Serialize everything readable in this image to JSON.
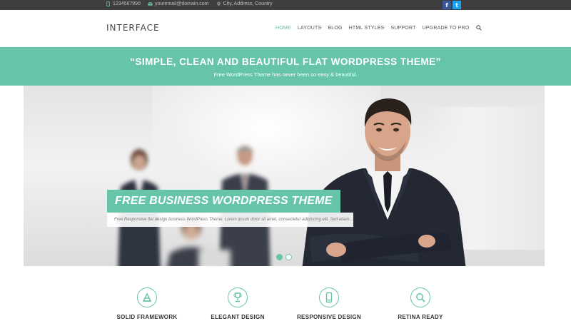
{
  "topbar": {
    "phone": "1234567890",
    "email": "youremail@domain.com",
    "address": "City, Address, Country",
    "social": [
      {
        "name": "facebook",
        "glyph": "f"
      },
      {
        "name": "twitter",
        "glyph": "t"
      }
    ]
  },
  "header": {
    "logo": "INTERFACE",
    "nav": [
      {
        "label": "HOME",
        "active": true
      },
      {
        "label": "LAYOUTS",
        "active": false
      },
      {
        "label": "BLOG",
        "active": false
      },
      {
        "label": "HTML STYLES",
        "active": false
      },
      {
        "label": "SUPPORT",
        "active": false
      },
      {
        "label": "UPGRADE TO PRO",
        "active": false
      }
    ],
    "search_icon": "search-icon"
  },
  "banner": {
    "title": "“SIMPLE, CLEAN AND BEAUTIFUL FLAT WORDPRESS THEME”",
    "subtitle": "Free WordPress Theme has never been so easy & beautiful."
  },
  "slider": {
    "caption_title": "FREE BUSINESS WORDPRESS THEME",
    "caption_text": "Free Responsive flat design business WordPress Theme. Lorem ipsum dolor sit amet, consectetur adipiscing elit. Sed etiam...",
    "active_slide": 1,
    "slide_count": 2
  },
  "features": [
    {
      "label": "SOLID FRAMEWORK",
      "icon": "framework-icon"
    },
    {
      "label": "ELEGANT DESIGN",
      "icon": "trophy-icon"
    },
    {
      "label": "RESPONSIVE DESIGN",
      "icon": "mobile-icon"
    },
    {
      "label": "RETINA READY",
      "icon": "magnifier-icon"
    }
  ],
  "colors": {
    "accent": "#66c4a8",
    "topbar": "#3e3e3e",
    "nav_active": "#5cc1a0"
  }
}
